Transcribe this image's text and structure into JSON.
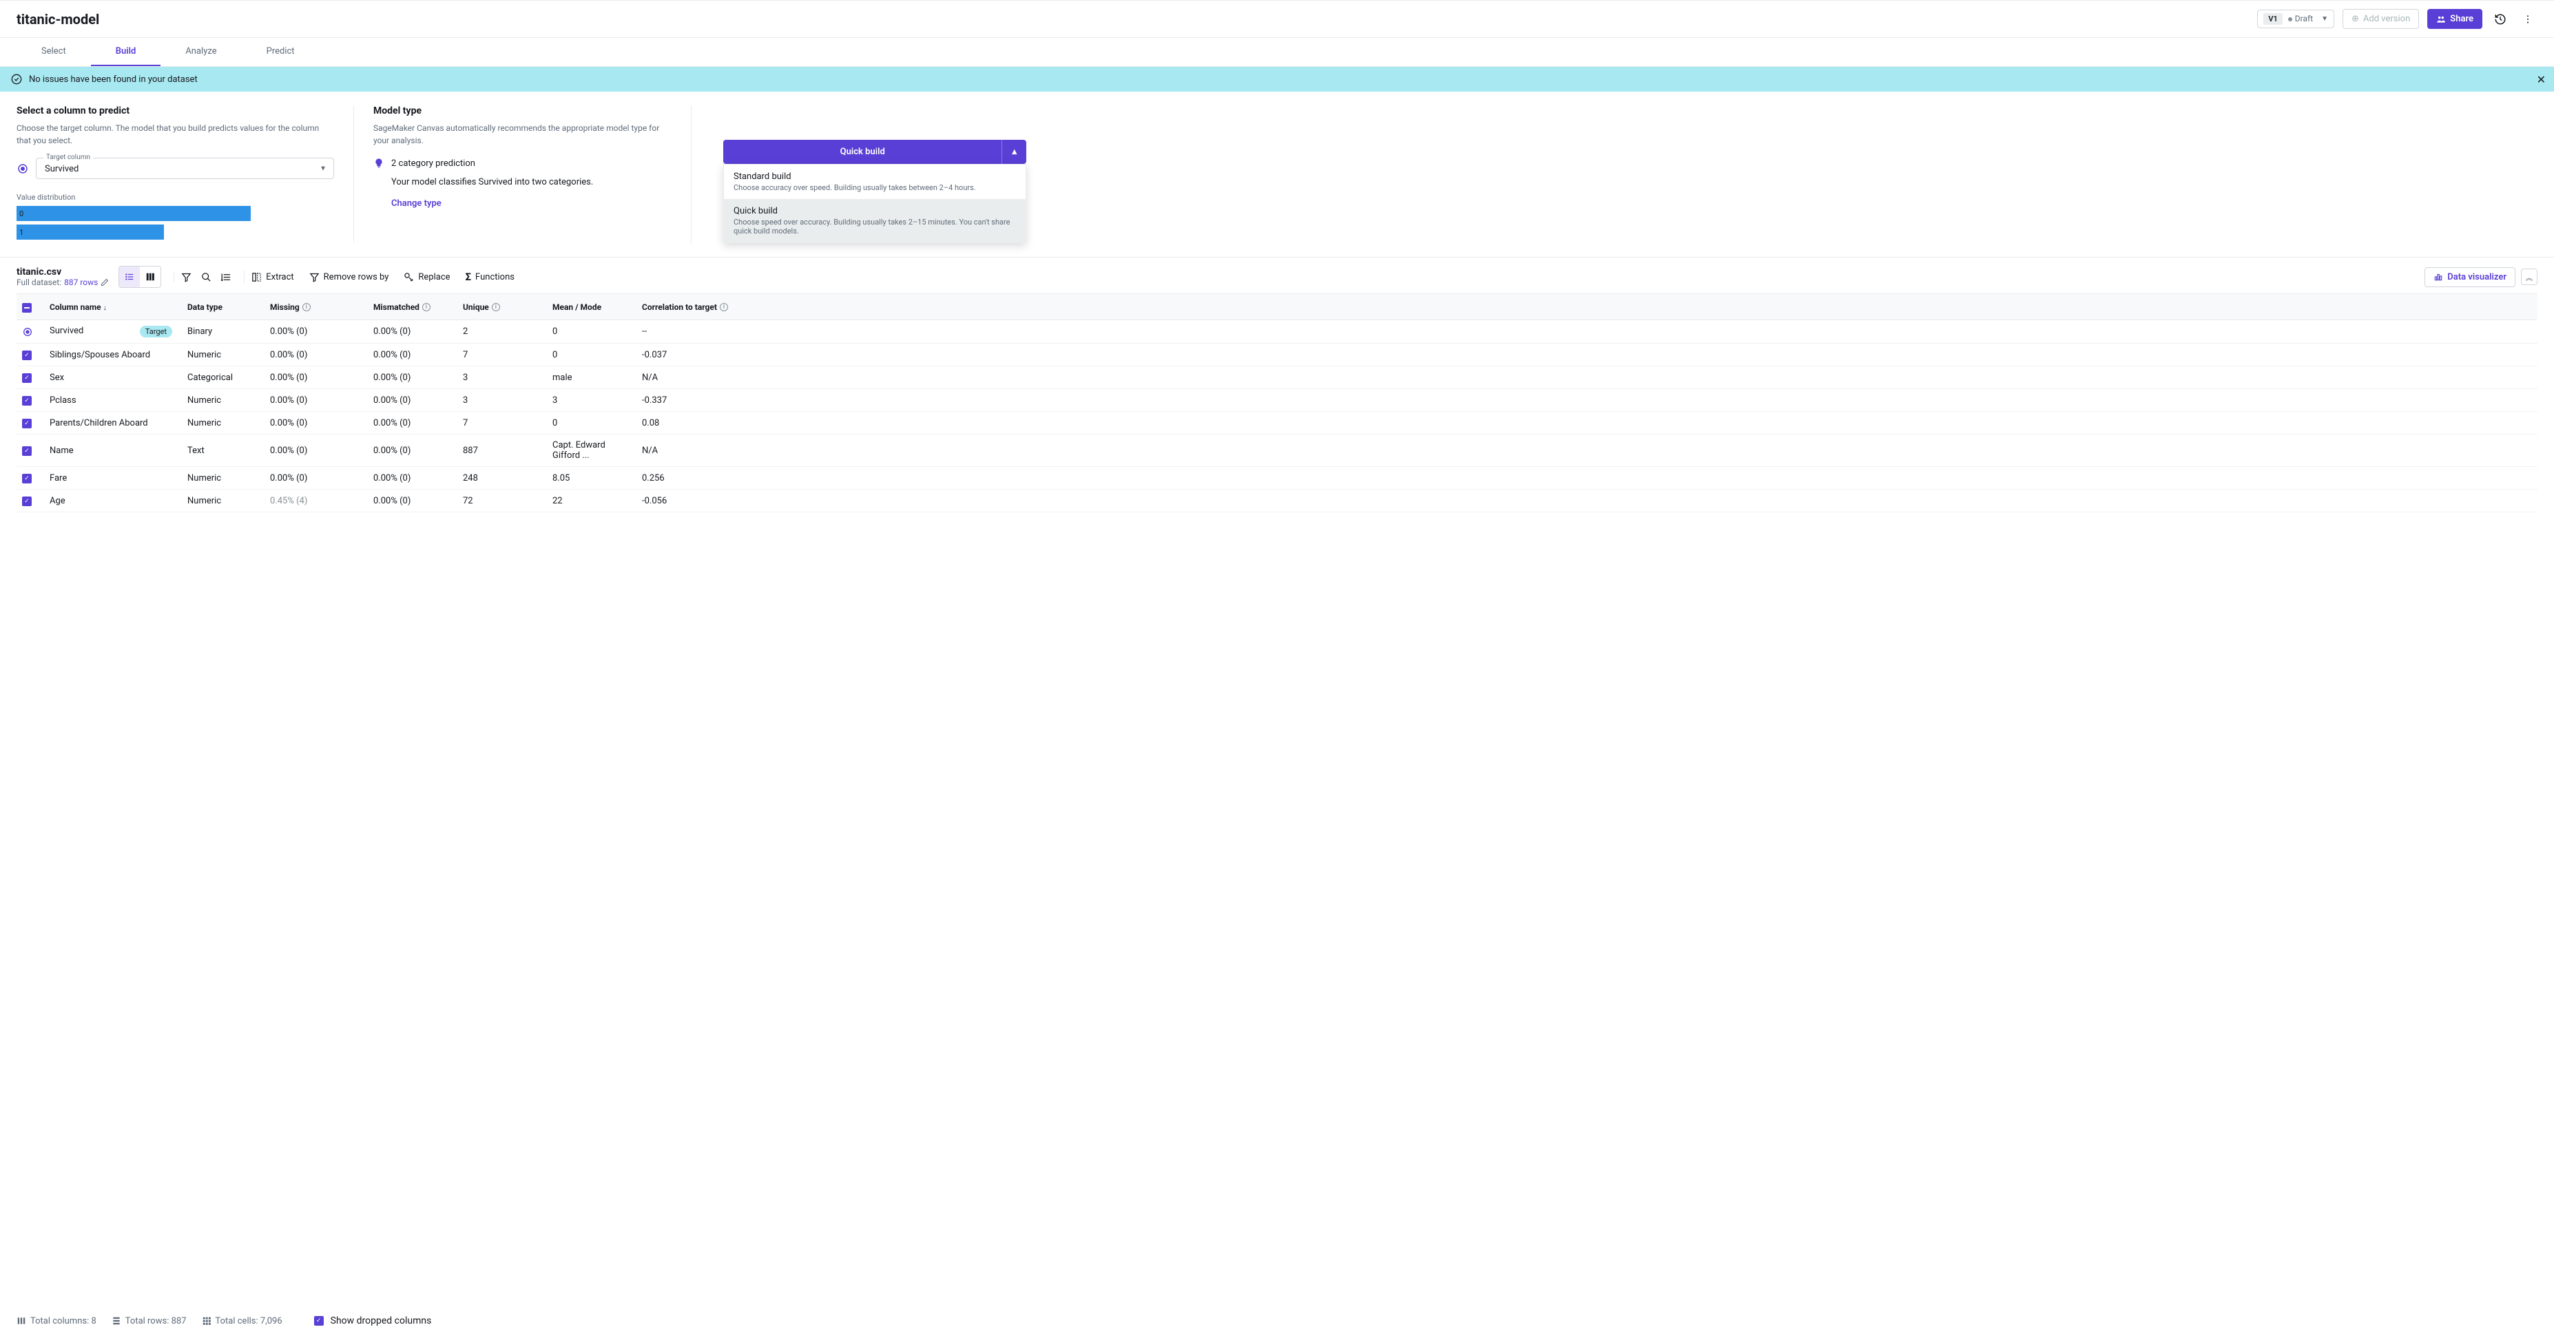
{
  "header": {
    "title": "titanic-model",
    "version_badge": "V1",
    "draft_label": "Draft",
    "add_version": "Add version",
    "share": "Share"
  },
  "tabs": [
    "Select",
    "Build",
    "Analyze",
    "Predict"
  ],
  "banner": {
    "message": "No issues have been found in your dataset"
  },
  "select_panel": {
    "title": "Select a column to predict",
    "desc": "Choose the target column. The model that you build predicts values for the column that you select.",
    "target_label": "Target column",
    "target_value": "Survived",
    "value_dist_label": "Value distribution",
    "bars": [
      {
        "label": "0",
        "class": "full"
      },
      {
        "label": "1",
        "class": "partial"
      }
    ]
  },
  "model_panel": {
    "title": "Model type",
    "desc": "SageMaker Canvas automatically recommends the appropriate model type for your analysis.",
    "prediction": "2 category prediction",
    "explanation": "Your model classifies Survived into two categories.",
    "change_type": "Change type"
  },
  "build_dropdown": {
    "button": "Quick build",
    "options": [
      {
        "title": "Standard build",
        "desc": "Choose accuracy over speed. Building usually takes between 2–4 hours.",
        "selected": false
      },
      {
        "title": "Quick build",
        "desc": "Choose speed over accuracy. Building usually takes 2–15 minutes. You can't share quick build models.",
        "selected": true
      }
    ]
  },
  "data_header": {
    "file": "titanic.csv",
    "full_dataset": "Full dataset:",
    "rows": "887 rows",
    "extract": "Extract",
    "remove_rows": "Remove rows by",
    "replace": "Replace",
    "functions": "Functions",
    "data_viz": "Data visualizer"
  },
  "table": {
    "headers": {
      "name": "Column name",
      "type": "Data type",
      "missing": "Missing",
      "mismatched": "Mismatched",
      "unique": "Unique",
      "mean": "Mean / Mode",
      "corr": "Correlation to target"
    },
    "target_badge": "Target",
    "rows": [
      {
        "check": "target",
        "name": "Survived",
        "type": "Binary",
        "missing": "0.00% (0)",
        "mismatched": "0.00% (0)",
        "unique": "2",
        "mean": "0",
        "corr": "--"
      },
      {
        "check": "on",
        "name": "Siblings/Spouses Aboard",
        "type": "Numeric",
        "missing": "0.00% (0)",
        "mismatched": "0.00% (0)",
        "unique": "7",
        "mean": "0",
        "corr": "-0.037"
      },
      {
        "check": "on",
        "name": "Sex",
        "type": "Categorical",
        "missing": "0.00% (0)",
        "mismatched": "0.00% (0)",
        "unique": "3",
        "mean": "male",
        "corr": "N/A"
      },
      {
        "check": "on",
        "name": "Pclass",
        "type": "Numeric",
        "missing": "0.00% (0)",
        "mismatched": "0.00% (0)",
        "unique": "3",
        "mean": "3",
        "corr": "-0.337"
      },
      {
        "check": "on",
        "name": "Parents/Children Aboard",
        "type": "Numeric",
        "missing": "0.00% (0)",
        "mismatched": "0.00% (0)",
        "unique": "7",
        "mean": "0",
        "corr": "0.08"
      },
      {
        "check": "on",
        "name": "Name",
        "type": "Text",
        "missing": "0.00% (0)",
        "mismatched": "0.00% (0)",
        "unique": "887",
        "mean": "Capt. Edward Gifford ...",
        "corr": "N/A"
      },
      {
        "check": "on",
        "name": "Fare",
        "type": "Numeric",
        "missing": "0.00% (0)",
        "mismatched": "0.00% (0)",
        "unique": "248",
        "mean": "8.05",
        "corr": "0.256"
      },
      {
        "check": "on",
        "name": "Age",
        "type": "Numeric",
        "missing": "0.45% (4)",
        "missing_muted": true,
        "mismatched": "0.00% (0)",
        "unique": "72",
        "mean": "22",
        "corr": "-0.056"
      }
    ]
  },
  "footer": {
    "total_columns": "Total columns: 8",
    "total_rows": "Total rows: 887",
    "total_cells": "Total cells: 7,096",
    "show_dropped": "Show dropped columns"
  }
}
